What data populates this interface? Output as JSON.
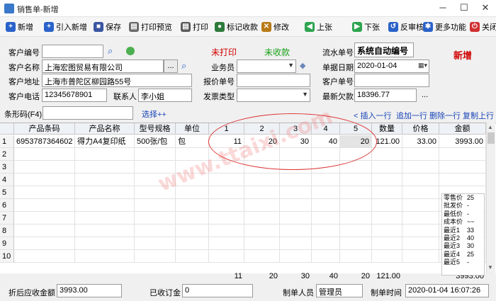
{
  "window": {
    "title": "销售单-新增",
    "min": "─",
    "max": "☐",
    "close": "✕"
  },
  "toolbar": [
    {
      "label": "新增",
      "glyph": "+",
      "color": "#2a62c9"
    },
    {
      "label": "引入新增",
      "glyph": "+",
      "color": "#2a62c9"
    },
    {
      "label": "保存",
      "glyph": "■",
      "color": "#3a55a0"
    },
    {
      "label": "打印预览",
      "glyph": "▤",
      "color": "#6a6a6a"
    },
    {
      "label": "打印",
      "glyph": "▤",
      "color": "#5a5a5a"
    },
    {
      "label": "标记收款",
      "glyph": "●",
      "color": "#2d7b3b"
    },
    {
      "label": "修改",
      "glyph": "✕",
      "color": "#b77a16"
    },
    {
      "label": "上张",
      "glyph": "◀",
      "color": "#2da44e"
    },
    {
      "label": "下张",
      "glyph": "▶",
      "color": "#2da44e"
    },
    {
      "label": "反审核",
      "glyph": "↺",
      "color": "#2a62c9"
    },
    {
      "label": "更多功能",
      "glyph": "✱",
      "color": "#2a62c9"
    },
    {
      "label": "关闭",
      "glyph": "⏻",
      "color": "#d03030"
    }
  ],
  "header": {
    "customer_no_label": "客户编号",
    "customer_no": "",
    "customer_name_label": "客户名称",
    "customer_name": "上海宏图贸易有限公司",
    "browse": "...",
    "address_label": "客户地址",
    "address": "上海市普陀区柳园路55号",
    "phone_label": "客户电话",
    "phone": "12345678901",
    "contact_label": "联系人",
    "contact": "李小姐",
    "print_status": "未打印",
    "collect_status": "未收款",
    "salesman_label": "业务员",
    "salesman": "",
    "quote_no_label": "报价单号",
    "quote_no": "",
    "invoice_type_label": "发票类型",
    "invoice_type": "",
    "serial_no_label": "流水单号",
    "serial_no": "系统自动编号",
    "date_label": "单据日期",
    "date": "2020-01-04",
    "customer_order_label": "客户单号",
    "customer_order": "",
    "latest_debt_label": "最新欠款",
    "latest_debt": "18396.77",
    "mode": "新增"
  },
  "barcode_bar": {
    "label": "条形码(F4)",
    "value": "",
    "select_more": "选择++",
    "actions": [
      "< 插入一行",
      "追加一行",
      "删除一行",
      "复制上行"
    ]
  },
  "grid": {
    "columns": [
      "产品条码",
      "产品名称",
      "型号规格",
      "单位",
      "1",
      "2",
      "3",
      "4",
      "5",
      "数量",
      "价格",
      "金额"
    ],
    "rows": [
      {
        "n": "1",
        "cells": [
          "6953787364602",
          "得力A4复印纸",
          "500张/包",
          "包",
          "11",
          "20",
          "30",
          "40",
          "20",
          "121.00",
          "33.00",
          "3993.00"
        ]
      },
      {
        "n": "2",
        "cells": [
          "",
          "",
          "",
          "",
          "",
          "",
          "",
          "",
          "",
          "",
          "",
          ""
        ]
      },
      {
        "n": "3",
        "cells": [
          "",
          "",
          "",
          "",
          "",
          "",
          "",
          "",
          "",
          "",
          "",
          ""
        ]
      },
      {
        "n": "4",
        "cells": [
          "",
          "",
          "",
          "",
          "",
          "",
          "",
          "",
          "",
          "",
          "",
          ""
        ]
      },
      {
        "n": "5",
        "cells": [
          "",
          "",
          "",
          "",
          "",
          "",
          "",
          "",
          "",
          "",
          "",
          ""
        ]
      },
      {
        "n": "6",
        "cells": [
          "",
          "",
          "",
          "",
          "",
          "",
          "",
          "",
          "",
          "",
          "",
          ""
        ]
      },
      {
        "n": "7",
        "cells": [
          "",
          "",
          "",
          "",
          "",
          "",
          "",
          "",
          "",
          "",
          "",
          ""
        ]
      },
      {
        "n": "8",
        "cells": [
          "",
          "",
          "",
          "",
          "",
          "",
          "",
          "",
          "",
          "",
          "",
          ""
        ]
      },
      {
        "n": "9",
        "cells": [
          "",
          "",
          "",
          "",
          "",
          "",
          "",
          "",
          "",
          "",
          "",
          ""
        ]
      },
      {
        "n": "10",
        "cells": [
          "",
          "",
          "",
          "",
          "",
          "",
          "",
          "",
          "",
          "",
          "",
          ""
        ]
      }
    ],
    "totals": [
      "",
      "",
      "",
      "",
      "11",
      "20",
      "30",
      "40",
      "20",
      "121.00",
      "",
      "3993.00"
    ]
  },
  "price_panel": [
    {
      "k": "零售价",
      "v": "25"
    },
    {
      "k": "批发价",
      "v": "-"
    },
    {
      "k": "最低价",
      "v": "-"
    },
    {
      "k": "成本价",
      "v": "~~"
    },
    {
      "k": "最近1",
      "v": "33"
    },
    {
      "k": "最近2",
      "v": "40"
    },
    {
      "k": "最近3",
      "v": "30"
    },
    {
      "k": "最近4",
      "v": "25"
    },
    {
      "k": "最近5",
      "v": "-"
    }
  ],
  "watermark": "www.ttaixi.com",
  "footer": {
    "receivable_label": "折后应收金额",
    "receivable": "3993.00",
    "deposit_label": "已收订金",
    "deposit": "0",
    "maker_label": "制单人员",
    "maker": "管理员",
    "time_label": "制单时间",
    "time": "2020-01-04 16:07:26"
  }
}
